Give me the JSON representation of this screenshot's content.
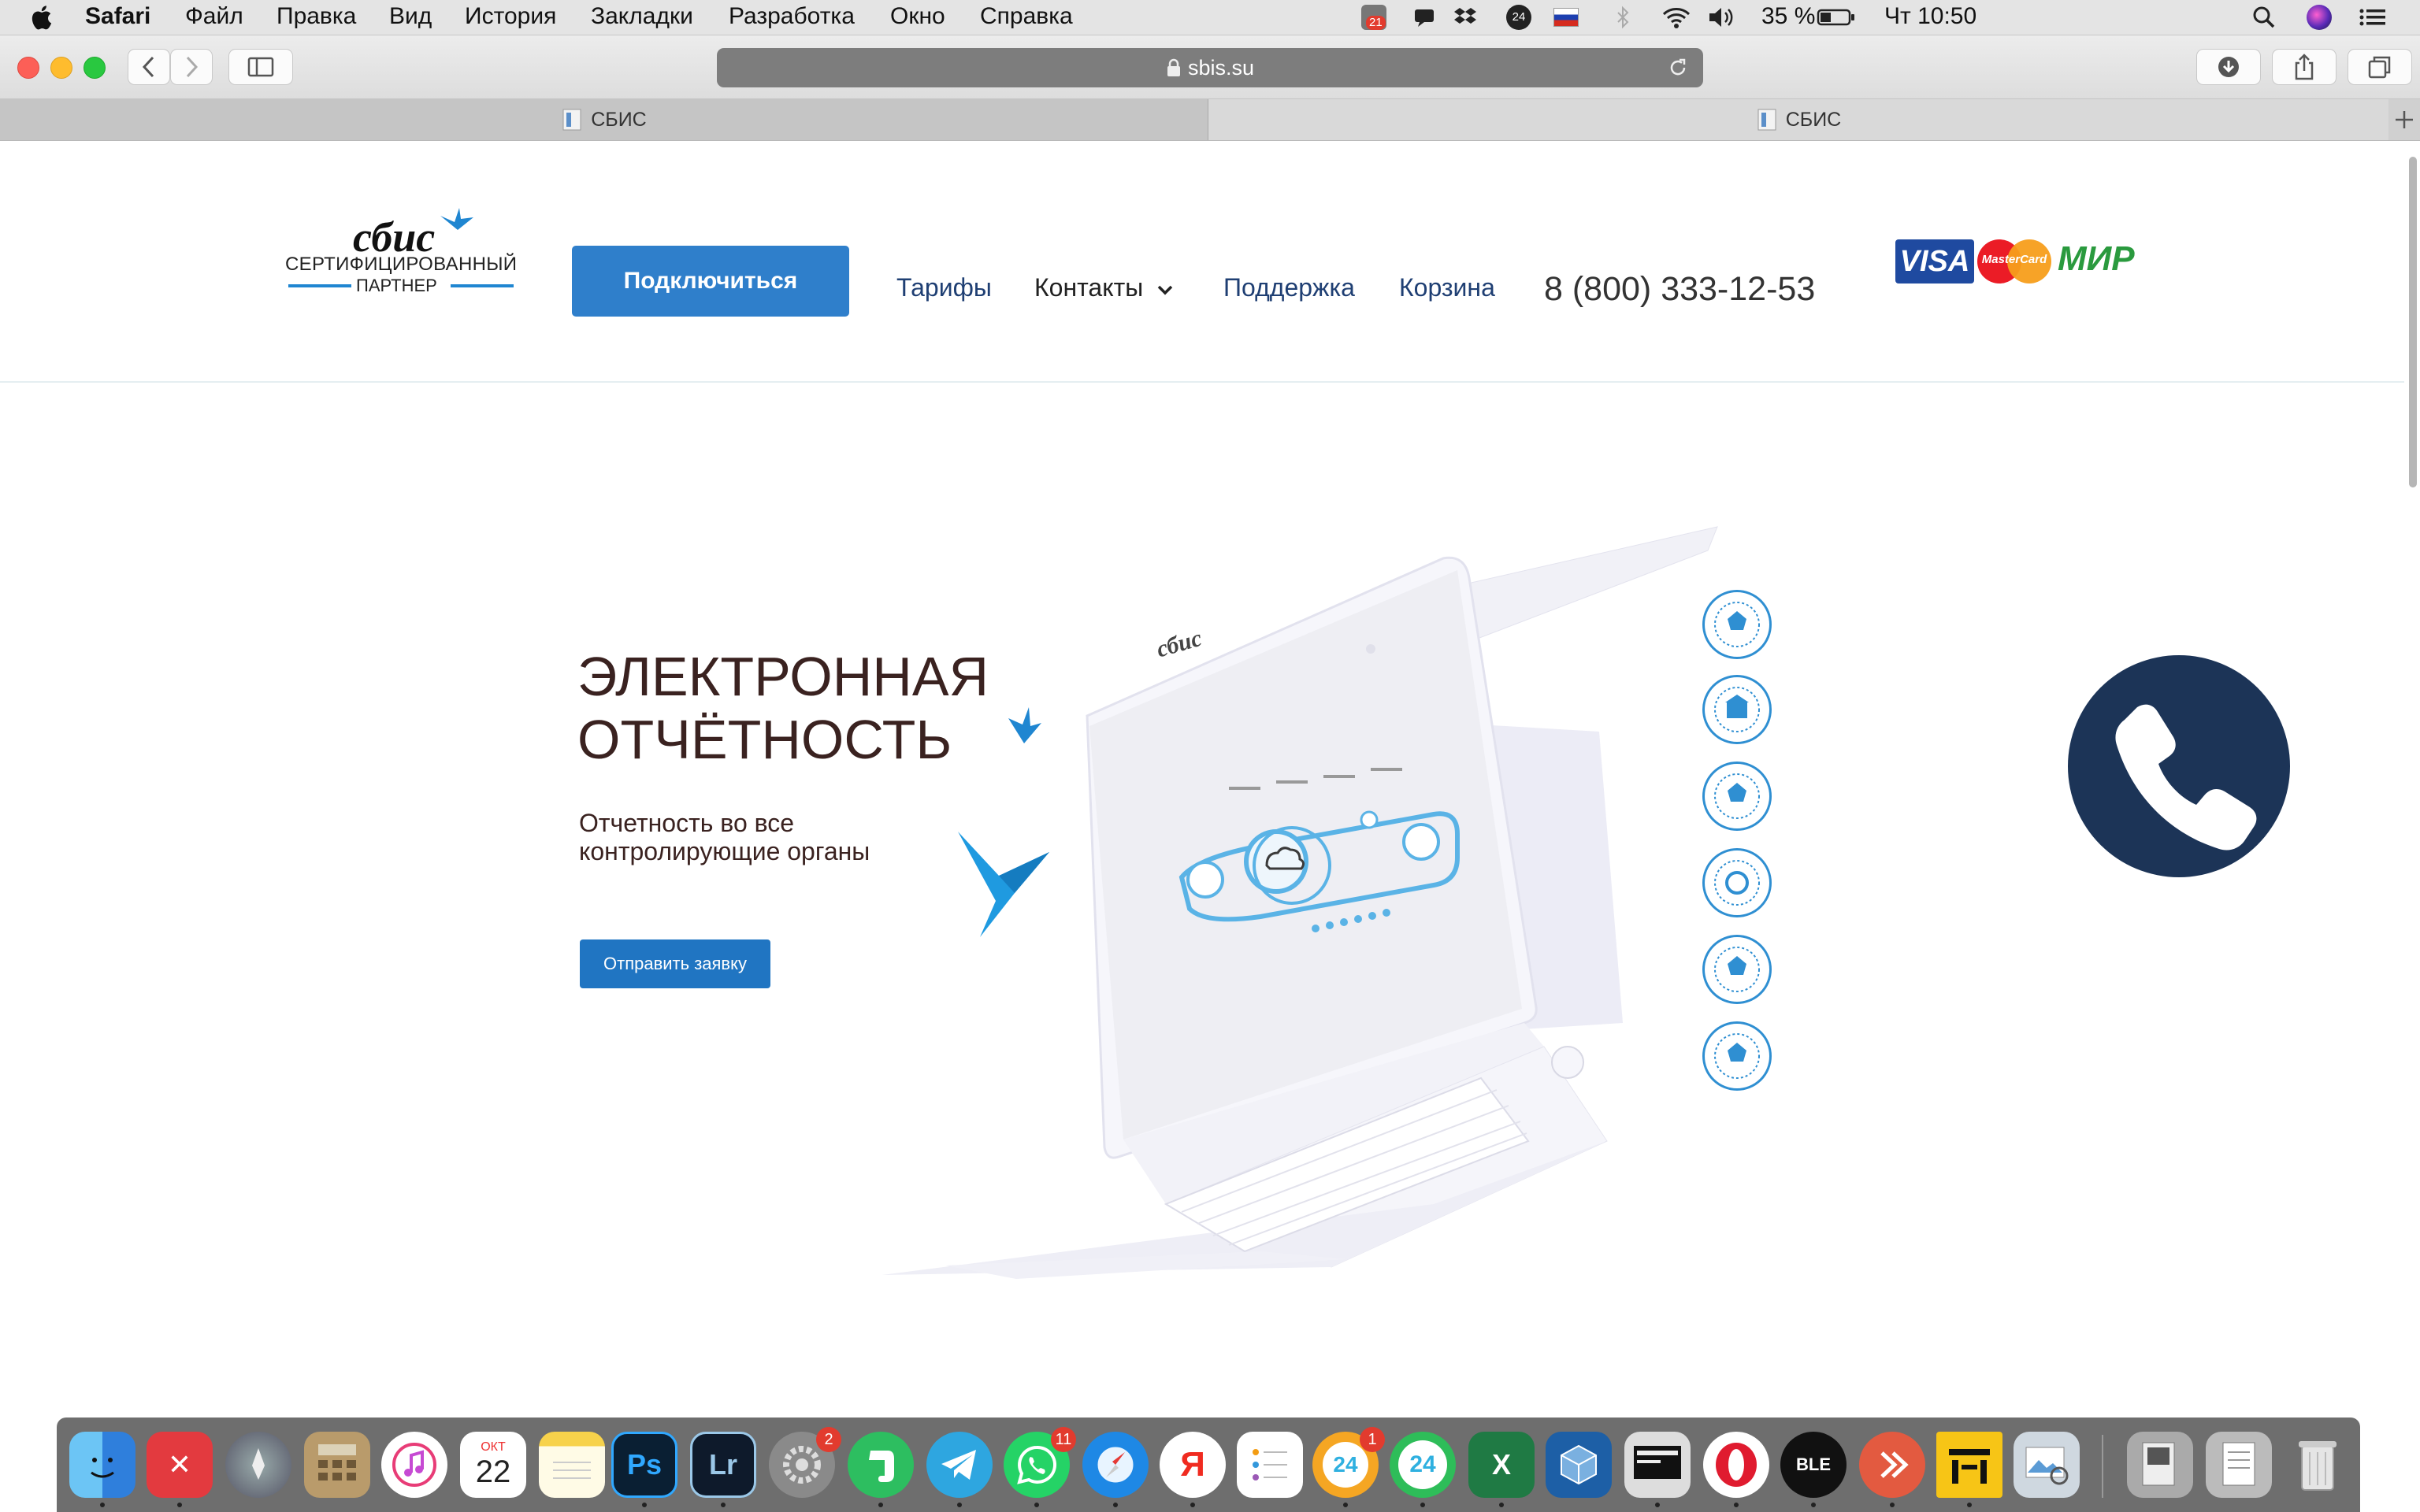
{
  "menubar": {
    "app_name": "Safari",
    "items": [
      "Файл",
      "Правка",
      "Вид",
      "История",
      "Закладки",
      "Разработка",
      "Окно",
      "Справка"
    ],
    "notification_count": "21",
    "battery": "35 %",
    "clock": "Чт 10:50"
  },
  "browser": {
    "url": "sbis.su",
    "tabs": [
      {
        "title": "СБИС"
      },
      {
        "title": "СБИС"
      }
    ]
  },
  "header": {
    "logo_word": "сбис",
    "logo_line1": "СЕРТИФИЦИРОВАННЫЙ",
    "logo_line2": "ПАРТНЕР",
    "connect_label": "Подключиться",
    "nav": {
      "tariffs": "Тарифы",
      "contacts": "Контакты",
      "support": "Поддержка",
      "cart": "Корзина"
    },
    "phone": "8 (800) 333-12-53",
    "payments": {
      "visa": "VISA",
      "mastercard": "MasterCard",
      "mir": "МИР"
    }
  },
  "hero": {
    "title_line1": "ЭЛЕКТРОННАЯ",
    "title_line2": "ОТЧЁТНОСТЬ",
    "subtitle_line1": "Отчетность во все",
    "subtitle_line2": "контролирующие органы",
    "apply_label": "Отправить заявку",
    "laptop_logo": "сбис"
  },
  "dock": {
    "badges": {
      "system_prefs": "2",
      "whatsapp": "11",
      "bitrix_chat": "1"
    },
    "calendar_month": "ОКТ",
    "calendar_day": "22",
    "labels": {
      "photoshop": "Ps",
      "lightroom": "Lr",
      "bitrix24": "24",
      "excel": "X",
      "yandex": "Я"
    }
  },
  "colors": {
    "brand_blue": "#2f7fcb",
    "nav_blue": "#1f3f73",
    "call_circle": "#1c3457",
    "hero_text": "#3a2220"
  }
}
